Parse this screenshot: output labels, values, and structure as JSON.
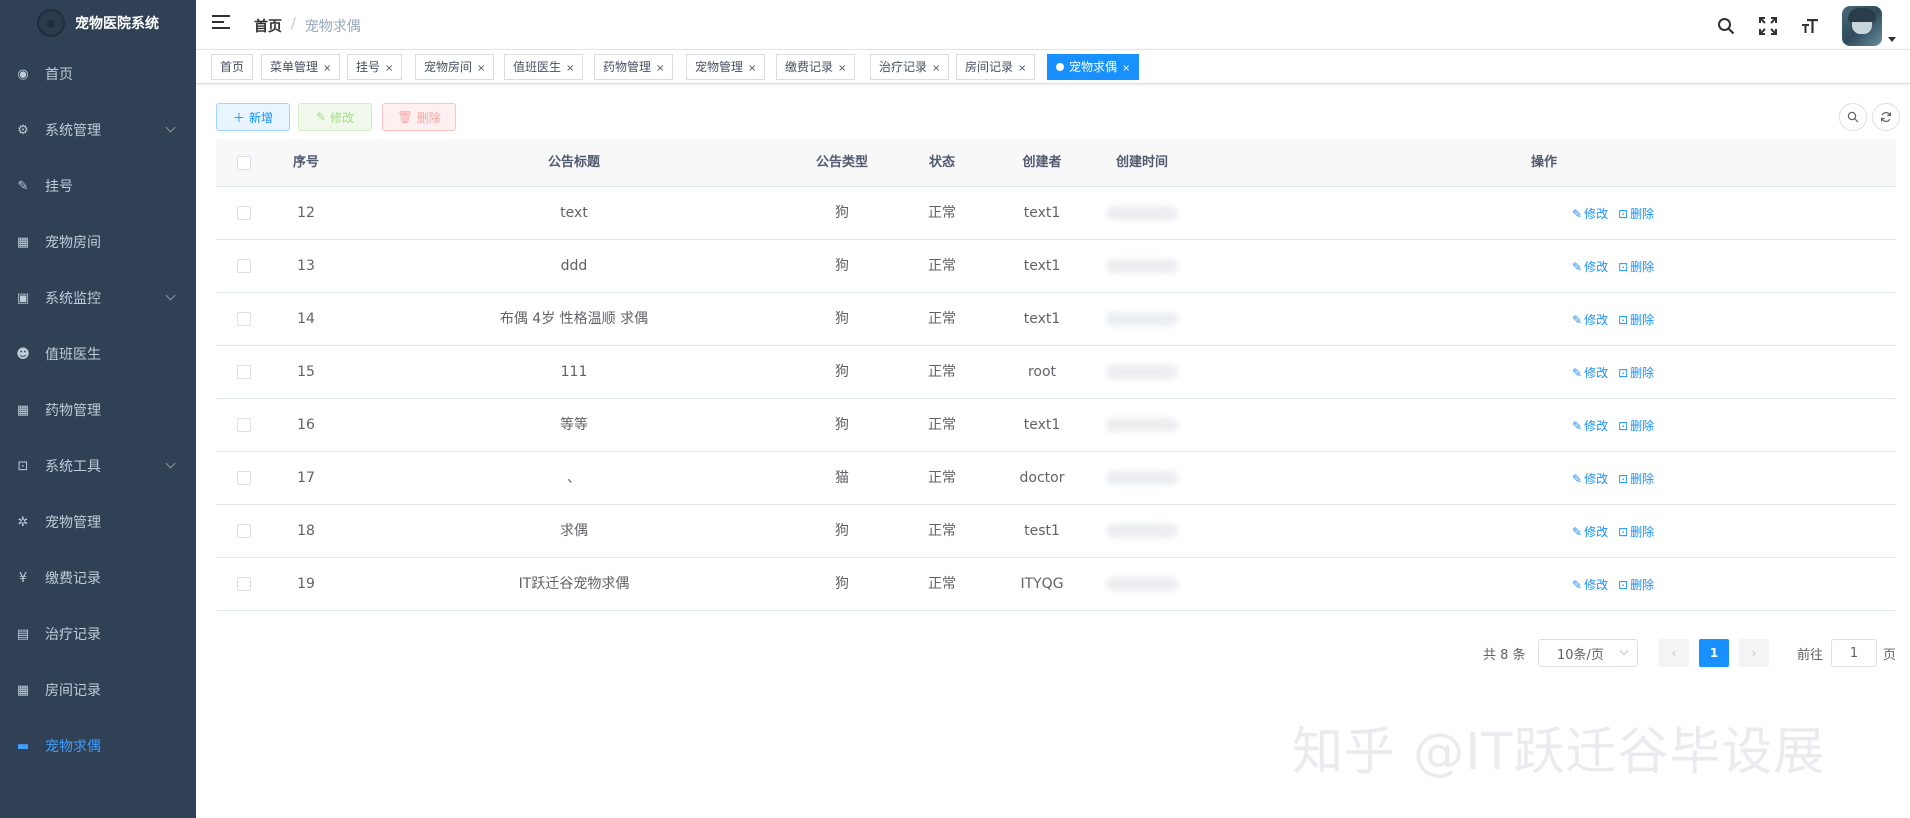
{
  "app": {
    "title": "宠物医院系统"
  },
  "sidebar": {
    "items": [
      {
        "label": "首页",
        "icon": "dashboard-icon",
        "glyph": "◉",
        "hasArrow": false,
        "active": false
      },
      {
        "label": "系统管理",
        "icon": "gear-icon",
        "glyph": "⚙",
        "hasArrow": true,
        "active": false
      },
      {
        "label": "挂号",
        "icon": "edit-icon",
        "glyph": "✎",
        "hasArrow": false,
        "active": false
      },
      {
        "label": "宠物房间",
        "icon": "table-icon",
        "glyph": "▦",
        "hasArrow": false,
        "active": false
      },
      {
        "label": "系统监控",
        "icon": "monitor-icon",
        "glyph": "▣",
        "hasArrow": true,
        "active": false
      },
      {
        "label": "值班医生",
        "icon": "peoples-icon",
        "glyph": "☻",
        "hasArrow": false,
        "active": false
      },
      {
        "label": "药物管理",
        "icon": "grid-icon",
        "glyph": "▦",
        "hasArrow": false,
        "active": false
      },
      {
        "label": "系统工具",
        "icon": "toolbox-icon",
        "glyph": "⊡",
        "hasArrow": true,
        "active": false
      },
      {
        "label": "宠物管理",
        "icon": "bug-icon",
        "glyph": "✲",
        "hasArrow": false,
        "active": false
      },
      {
        "label": "缴费记录",
        "icon": "yen-icon",
        "glyph": "¥",
        "hasArrow": false,
        "active": false
      },
      {
        "label": "治疗记录",
        "icon": "document-icon",
        "glyph": "▤",
        "hasArrow": false,
        "active": false
      },
      {
        "label": "房间记录",
        "icon": "table-icon",
        "glyph": "▦",
        "hasArrow": false,
        "active": false
      },
      {
        "label": "宠物求偶",
        "icon": "message-icon",
        "glyph": "▬",
        "hasArrow": false,
        "active": true
      }
    ]
  },
  "navbar": {
    "breadcrumb": {
      "home": "首页",
      "separator": "/",
      "current": "宠物求偶"
    }
  },
  "tags": [
    {
      "label": "首页",
      "closable": false,
      "active": false
    },
    {
      "label": "菜单管理",
      "closable": true,
      "active": false
    },
    {
      "label": "挂号",
      "closable": true,
      "active": false
    },
    {
      "label": "宠物房间",
      "closable": true,
      "active": false
    },
    {
      "label": "值班医生",
      "closable": true,
      "active": false
    },
    {
      "label": "药物管理",
      "closable": true,
      "active": false
    },
    {
      "label": "宠物管理",
      "closable": true,
      "active": false
    },
    {
      "label": "缴费记录",
      "closable": true,
      "active": false
    },
    {
      "label": "治疗记录",
      "closable": true,
      "active": false
    },
    {
      "label": "房间记录",
      "closable": true,
      "active": false
    },
    {
      "label": "宠物求偶",
      "closable": true,
      "active": true
    }
  ],
  "toolbar": {
    "add": "新增",
    "edit": "修改",
    "delete": "删除"
  },
  "table": {
    "headers": {
      "index": "序号",
      "title": "公告标题",
      "type": "公告类型",
      "status": "状态",
      "creator": "创建者",
      "created": "创建时间",
      "ops": "操作"
    },
    "edit_label": "修改",
    "delete_label": "删除",
    "rows": [
      {
        "id": "12",
        "title": "text",
        "type": "狗",
        "status": "正常",
        "creator": "text1"
      },
      {
        "id": "13",
        "title": "ddd",
        "type": "狗",
        "status": "正常",
        "creator": "text1"
      },
      {
        "id": "14",
        "title": "布偶 4岁 性格温顺 求偶",
        "type": "狗",
        "status": "正常",
        "creator": "text1"
      },
      {
        "id": "15",
        "title": "111",
        "type": "狗",
        "status": "正常",
        "creator": "root"
      },
      {
        "id": "16",
        "title": "等等",
        "type": "狗",
        "status": "正常",
        "creator": "text1"
      },
      {
        "id": "17",
        "title": "、",
        "type": "猫",
        "status": "正常",
        "creator": "doctor"
      },
      {
        "id": "18",
        "title": "求偶",
        "type": "狗",
        "status": "正常",
        "creator": "test1"
      },
      {
        "id": "19",
        "title": "IT跃迁谷宠物求偶",
        "type": "狗",
        "status": "正常",
        "creator": "ITYQG"
      }
    ]
  },
  "pagination": {
    "total_text": "共 8 条",
    "page_size": "10条/页",
    "current_page": "1",
    "goto_label": "前往",
    "goto_value": "1",
    "page_unit": "页"
  },
  "watermark": "知乎 @IT跃迁谷毕设展"
}
